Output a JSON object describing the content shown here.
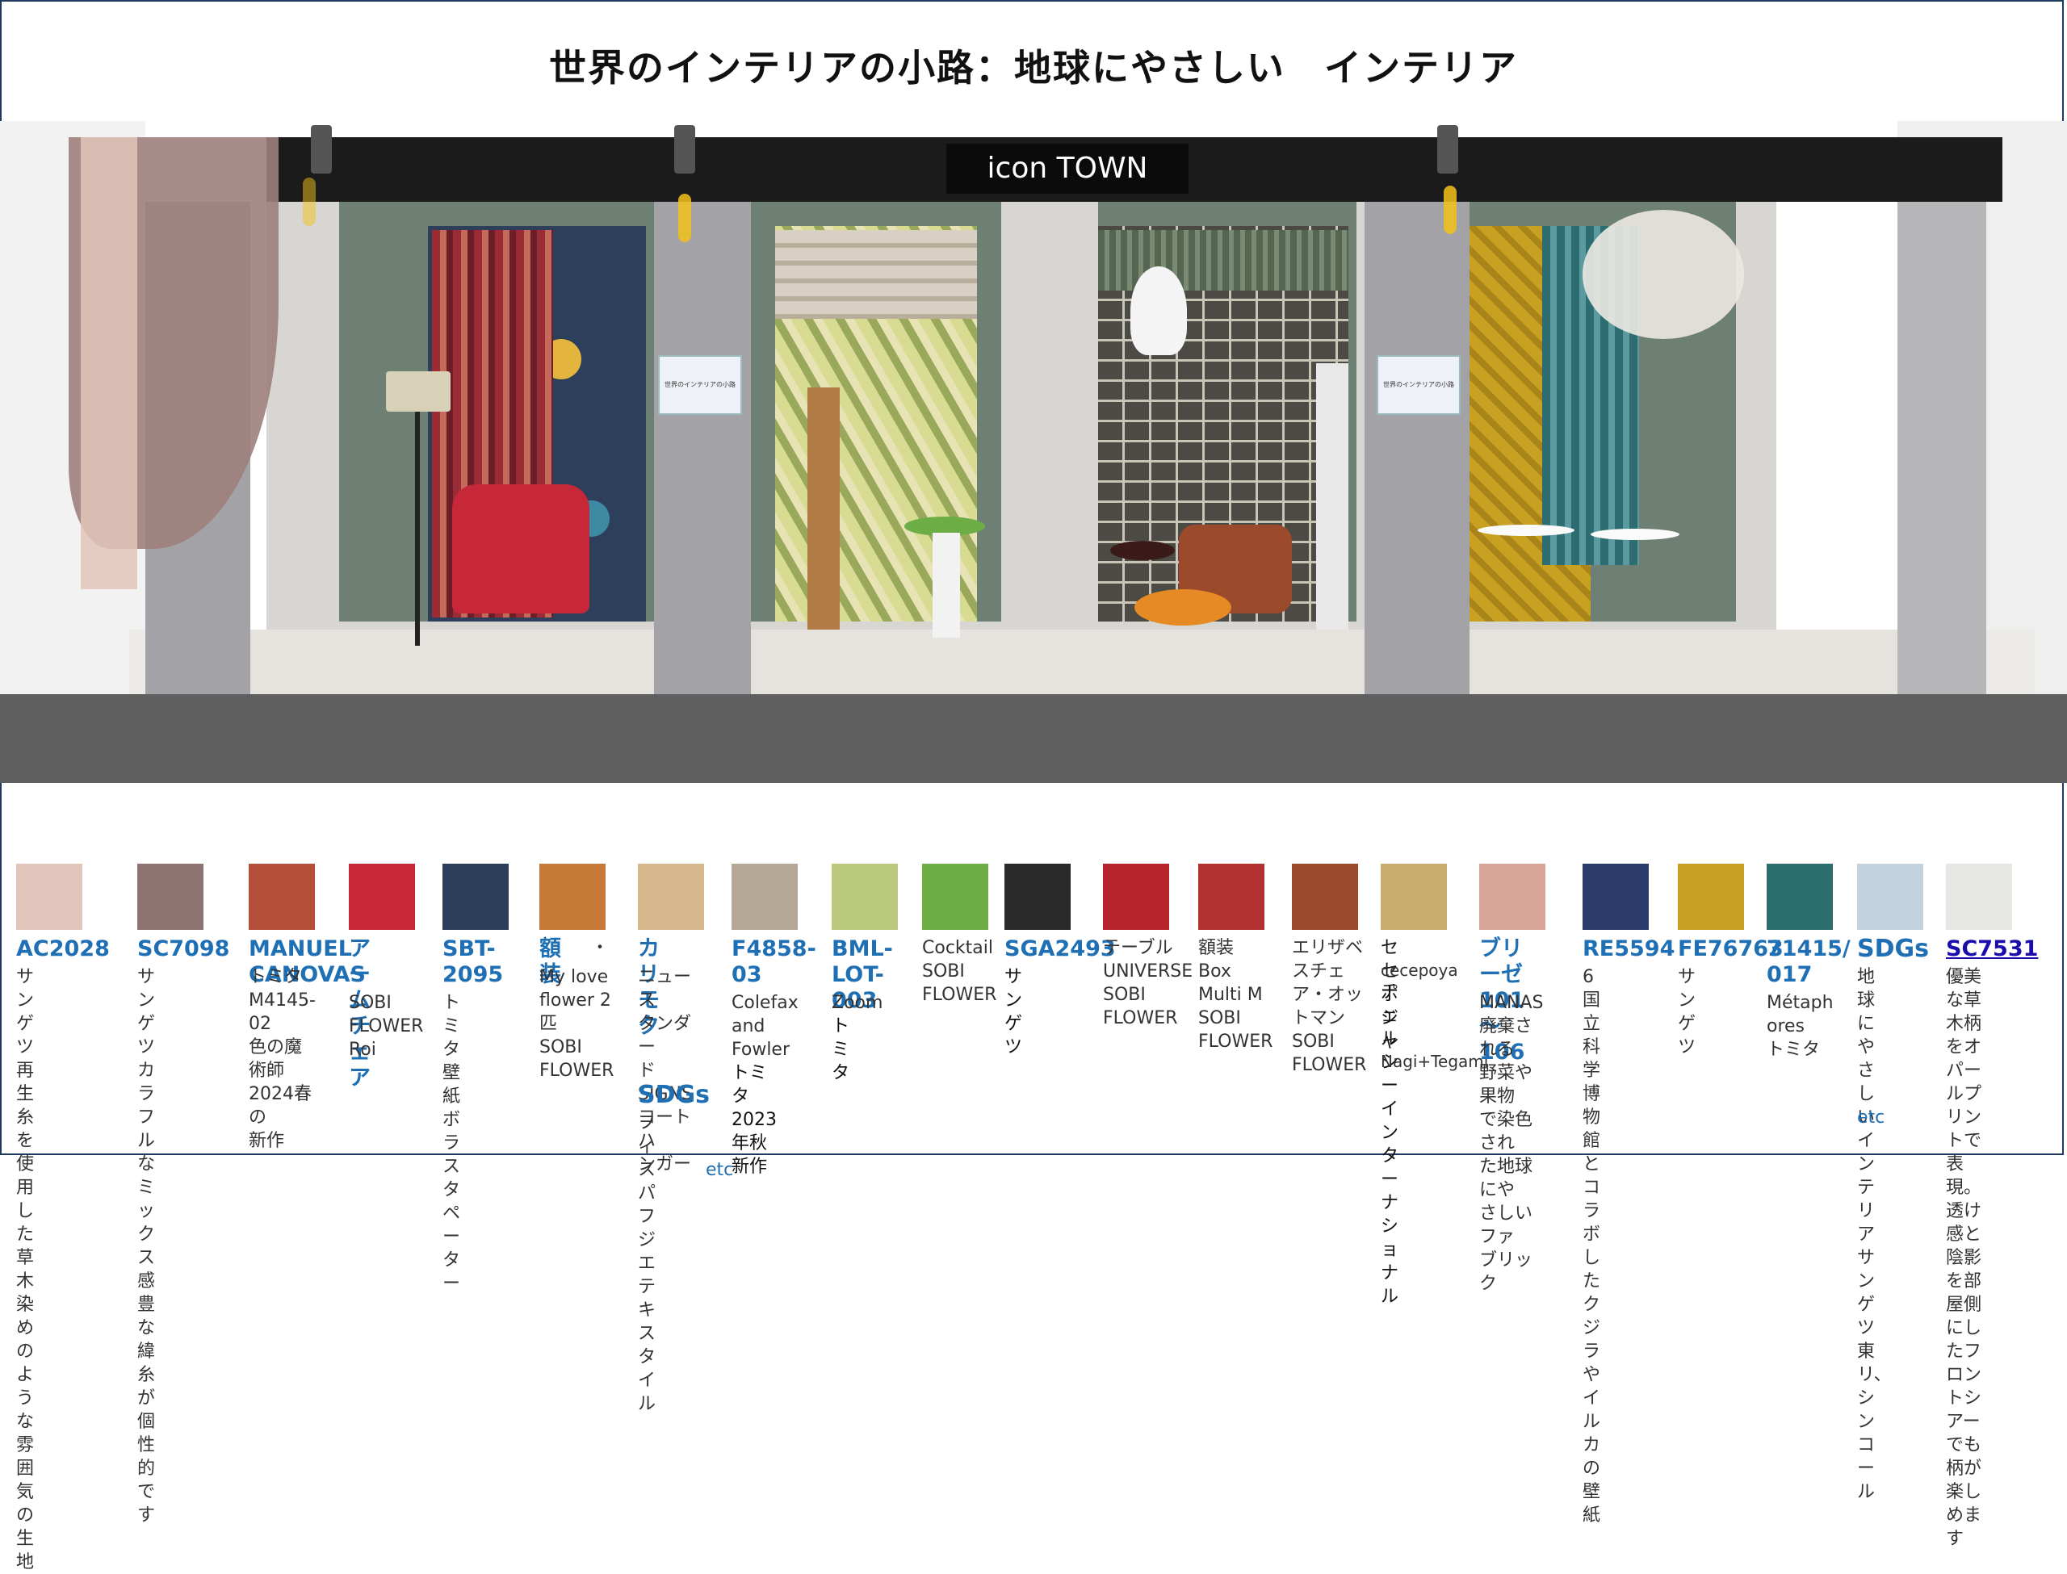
{
  "page": {
    "title": "世界のインテリアの小路：地球にやさしい　インテリア"
  },
  "stage": {
    "sign": "icon TOWN",
    "wall_label": "世界のインテリアの小路"
  },
  "legend": [
    {
      "code": "AC2028",
      "desc": "サンゲツ\n再生糸を使用した草木染めのような雰囲気の生地",
      "swatch_color": "#e2c6bb"
    },
    {
      "code": "SC7098",
      "desc": "サンゲツ\nカラフルな\nミックス感\n豊な緯糸が\n個性的です",
      "swatch_color": "#8d7371"
    },
    {
      "code": "MANUEL CANOVAS",
      "desc": "トミタ\nM4145-02\n色の魔術師\n2024春の\n新作",
      "swatch_color": "#b54f3a"
    },
    {
      "code": "アーム\nチェア",
      "desc": "SOBI\nFLOWER\nRoi",
      "swatch_color": "#c6283a"
    },
    {
      "code": "SBT-\n2095",
      "desc": "トミタ\n壁紙\nボラスタ\nペーター",
      "swatch_color": "#2b3d59"
    },
    {
      "code": "額装",
      "code_suffix": "・",
      "desc": "My love\nflower 2\n匹\nSOBI\nFLOWER",
      "swatch_color": "#c77a38"
    },
    {
      "code": "カリモク",
      "desc": "ニュース\nタンダー\nドSIGNS\nコートハ\nンガー",
      "sdgs": "SDGs",
      "desc2": "フィスパ\nフジエテキ\nスタイル",
      "etc": "etc",
      "swatch_color": "#d5b98d"
    },
    {
      "code": "F4858-\n03",
      "desc": "Colefax\nand\nFowler",
      "desc_dark": "トミタ\n2023年秋\n新作",
      "swatch_color": "#b6a897"
    },
    {
      "code": "BML-\nLOT-003",
      "desc": "Zoom",
      "desc_dark": "トミタ",
      "swatch_color": "#b9c87c"
    },
    {
      "code": "",
      "desc": "Cocktail\nSOBI\nFLOWER",
      "swatch_color": "#6cae45"
    },
    {
      "code": "SGA2493",
      "desc_dark": "サンゲツ",
      "swatch_color": "#2a2a2a"
    },
    {
      "code": "",
      "desc": "テーブル\nUNIVERSE\nSOBI\nFLOWER",
      "swatch_color": "#b8242c"
    },
    {
      "code": "",
      "desc": "額装　Box\nMulti M\nSOBI\nFLOWER",
      "swatch_color": "#b13030"
    },
    {
      "code": "",
      "desc": "エリザベ\nスチェ\nア・オッ\nトマン\nSOBI\nFLOWER",
      "swatch_color": "#9c4a2c"
    },
    {
      "code": "",
      "desc_dark": "セセポジャ",
      "desc_small": "cecepoya",
      "desc_dark2": "チェルシーイ\nンターナショ\nナル",
      "desc_small2": "Nagi+Tegami",
      "swatch_color": "#c8ab6e"
    },
    {
      "code": "ブリーゼ\n101～106",
      "desc": "MANAS\n廃棄される\n野菜や果物\nで染色され\nた地球にや\nさしいファ\nブリック",
      "swatch_color": "#d7a497"
    },
    {
      "code": "RE5594",
      "desc": "6国立科\n学博物館\nとコラボ\nしたクジ\nラやイル\nカの壁紙",
      "swatch_color": "#2a3b6b"
    },
    {
      "code": "FE76763",
      "desc": "サンゲツ",
      "swatch_color": "#c8a022"
    },
    {
      "code": "71415/\n017",
      "desc": "Métaph\nores\nトミタ",
      "swatch_color": "#2c6d6d"
    },
    {
      "code": "SDGs",
      "desc": "地球にや\nさしいイ\nンテリア\nサンゲツ\n東リ、シ\nンコール",
      "etc": "etc",
      "swatch_color": "#c2d2de"
    },
    {
      "code": "SC7531",
      "desc": "優美な草木柄\nをオパールプ\nリントで表現。\n透け感と陰影\nを部屋側にし\nたフロントシ\nアーでも柄が\n楽しめます",
      "swatch_color": "#e7e7e4"
    }
  ]
}
